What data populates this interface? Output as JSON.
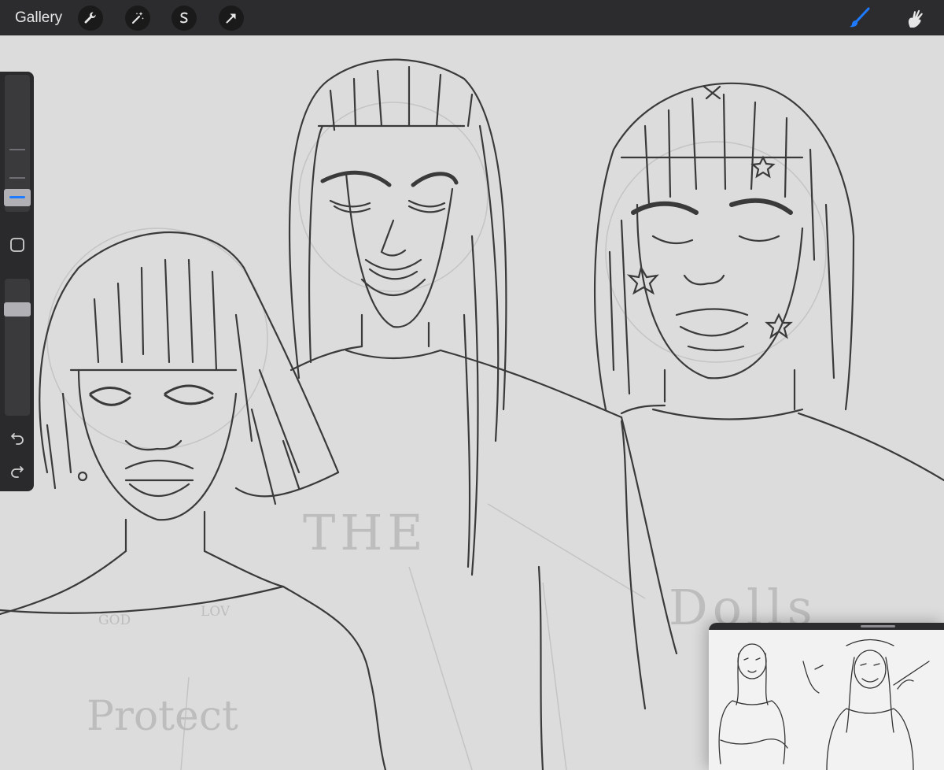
{
  "topbar": {
    "gallery_label": "Gallery",
    "left_tools": [
      "wrench-icon",
      "magic-wand-icon",
      "selection-icon",
      "transform-arrow-icon"
    ],
    "right_tools": [
      "brush-icon",
      "smudge-icon"
    ],
    "accent": "#1e7bff",
    "background": "#2c2c2e"
  },
  "sidebar": {
    "brush_size_level": 0.08,
    "opacity_level": 0.17,
    "buttons": [
      "modify-square-button",
      "undo-button",
      "redo-button"
    ]
  },
  "canvas": {
    "sketch_words": [
      "THE",
      "Dolls",
      "GOD",
      "LOV",
      "Protect"
    ]
  },
  "reference_window": {
    "visible": true
  }
}
